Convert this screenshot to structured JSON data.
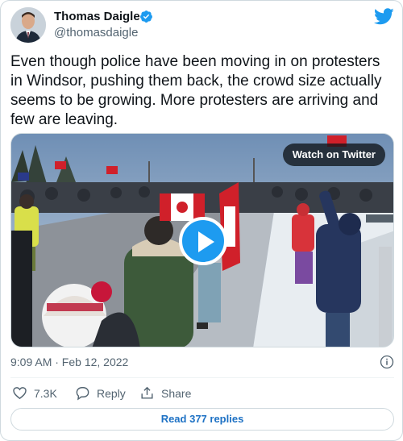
{
  "author": {
    "name": "Thomas Daigle",
    "handle": "@thomasdaigle"
  },
  "icons": {
    "verified": "verified-badge-icon",
    "twitter": "twitter-bird-icon",
    "info": "info-icon",
    "like": "heart-icon",
    "reply": "reply-bubble-icon",
    "share": "share-upload-icon"
  },
  "tweet": {
    "text": "Even though police have been moving in on protesters in Windsor, pushing them back, the crowd size actually seems to be growing. More protesters are arriving and few are leaving.",
    "timestamp": "9:09 AM · Feb 12, 2022"
  },
  "media": {
    "watch_label": "Watch on Twitter"
  },
  "actions": {
    "likes": "7.3K",
    "reply_label": "Reply",
    "share_label": "Share"
  },
  "footer": {
    "read_replies": "Read 377 replies"
  },
  "colors": {
    "accent": "#1d9bf0",
    "link": "#1d71c4",
    "muted_text": "#536471",
    "border": "#cfd9de"
  }
}
